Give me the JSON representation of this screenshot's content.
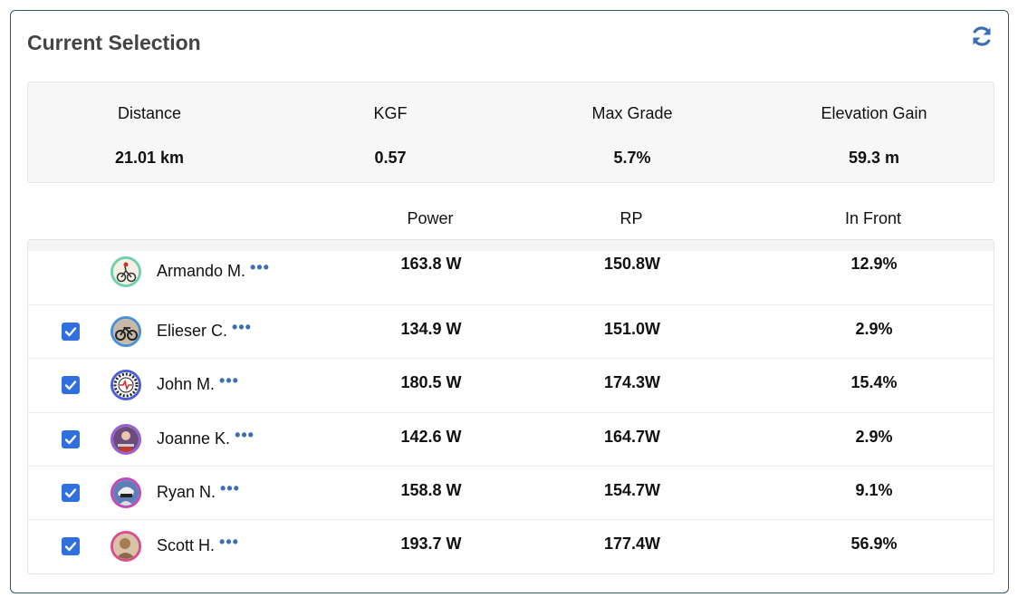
{
  "panel": {
    "title": "Current Selection",
    "refresh_icon": "refresh-icon",
    "accent_color": "#3a6fb5"
  },
  "stats": [
    {
      "label": "Distance",
      "value": "21.01 km"
    },
    {
      "label": "KGF",
      "value": "0.57"
    },
    {
      "label": "Max Grade",
      "value": "5.7%"
    },
    {
      "label": "Elevation Gain",
      "value": "59.3 m"
    }
  ],
  "table": {
    "headers": [
      "Power",
      "RP",
      "In Front"
    ],
    "rows": [
      {
        "checked": false,
        "name": "Armando M.",
        "more": "•••",
        "power": "163.8 W",
        "rp": "150.8W",
        "in_front": "12.9%",
        "avatar_icon": "rider-avatar-icon",
        "ring_color": "#6fd0b0"
      },
      {
        "checked": true,
        "name": "Elieser C.",
        "more": "•••",
        "power": "134.9 W",
        "rp": "151.0W",
        "in_front": "2.9%",
        "avatar_icon": "bike-avatar-icon",
        "ring_color": "#4a90d9"
      },
      {
        "checked": true,
        "name": "John M.",
        "more": "•••",
        "power": "180.5 W",
        "rp": "174.3W",
        "in_front": "15.4%",
        "avatar_icon": "gear-avatar-icon",
        "ring_color": "#4b5fd6"
      },
      {
        "checked": true,
        "name": "Joanne K.",
        "more": "•••",
        "power": "142.6 W",
        "rp": "164.7W",
        "in_front": "2.9%",
        "avatar_icon": "rider-avatar-icon",
        "ring_color": "#9a5fd0"
      },
      {
        "checked": true,
        "name": "Ryan N.",
        "more": "•••",
        "power": "158.8 W",
        "rp": "154.7W",
        "in_front": "9.1%",
        "avatar_icon": "helmet-avatar-icon",
        "ring_color": "#c04ab8"
      },
      {
        "checked": true,
        "name": "Scott H.",
        "more": "•••",
        "power": "193.7 W",
        "rp": "177.4W",
        "in_front": "56.9%",
        "avatar_icon": "rider-avatar-icon",
        "ring_color": "#d9508a"
      }
    ]
  }
}
